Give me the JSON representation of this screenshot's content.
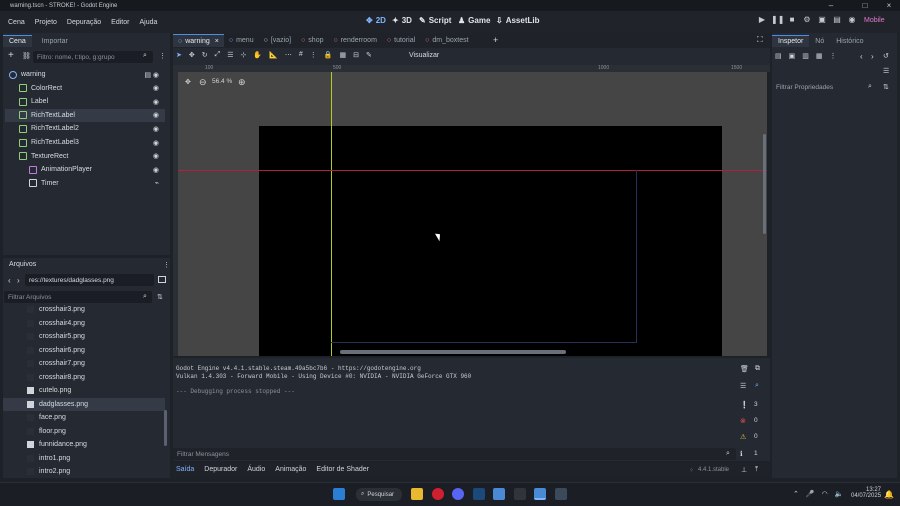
{
  "window": {
    "title": "warning.tscn - STROKE! - Godot Engine"
  },
  "menu": [
    "Cena",
    "Projeto",
    "Depuração",
    "Editor",
    "Ajuda"
  ],
  "workspaces": [
    {
      "label": "2D",
      "icon": "2d-icon",
      "active": true
    },
    {
      "label": "3D",
      "icon": "3d-icon"
    },
    {
      "label": "Script",
      "icon": "script-icon"
    },
    {
      "label": "Game",
      "icon": "game-icon"
    },
    {
      "label": "AssetLib",
      "icon": "assetlib-icon"
    }
  ],
  "renderer": "Mobile",
  "scene_panel": {
    "tabs": [
      "Cena",
      "Importar"
    ],
    "filter_placeholder": "Filtro: nome, t:tipo, g:grupo",
    "nodes": [
      {
        "name": "warning",
        "icon": "node-icon",
        "depth": 0
      },
      {
        "name": "ColorRect",
        "icon": "colorrect-icon",
        "depth": 1
      },
      {
        "name": "Label",
        "icon": "label-icon",
        "depth": 1
      },
      {
        "name": "RichTextLabel",
        "icon": "richtext-icon",
        "depth": 1,
        "selected": true
      },
      {
        "name": "RichTextLabel2",
        "icon": "richtext-icon",
        "depth": 1
      },
      {
        "name": "RichTextLabel3",
        "icon": "richtext-icon",
        "depth": 1
      },
      {
        "name": "TextureRect",
        "icon": "texturerect-icon",
        "depth": 1
      },
      {
        "name": "AnimationPlayer",
        "icon": "animationplayer-icon",
        "depth": 2
      },
      {
        "name": "Timer",
        "icon": "timer-icon",
        "depth": 2
      }
    ]
  },
  "files_panel": {
    "title": "Arquivos",
    "path": "res://textures/dadglasses.png",
    "filter_placeholder": "Filtrar Arquivos",
    "files": [
      "crosshair3.png",
      "crosshair4.png",
      "crosshair5.png",
      "crosshair6.png",
      "crosshair7.png",
      "crosshair8.png",
      "cutelo.png",
      "dadglasses.png",
      "face.png",
      "floor.png",
      "funnidance.png",
      "intro1.png",
      "intro2.png"
    ],
    "selected": "dadglasses.png"
  },
  "scene_tabs": [
    "warning",
    "menu",
    "[vazio]",
    "shop",
    "renderroom",
    "tutorial",
    "dm_boxtest"
  ],
  "toolbar": {
    "visualizar": "Visualizar",
    "zoom": "56.4 %"
  },
  "ruler_labels": [
    "100",
    "500",
    "1000",
    "1500"
  ],
  "inspector": {
    "tabs": [
      "Inspetor",
      "Nó",
      "Histórico"
    ],
    "filter_placeholder": "Filtrar Propriedades"
  },
  "output": {
    "lines": [
      "Godot Engine v4.4.1.stable.steam.49a5bc7b6 - https://godotengine.org",
      "Vulkan 1.4.303 - Forward Mobile - Using Device #0: NVIDIA - NVIDIA GeForce GTX 960",
      "",
      "--- Debugging process stopped ---"
    ],
    "filter_placeholder": "Filtrar Mensagens",
    "counts": {
      "messages": "3",
      "errors": "0",
      "warnings": "0",
      "info": "1"
    }
  },
  "bottom_tabs": [
    "Saída",
    "Depurador",
    "Áudio",
    "Animação",
    "Editor de Shader"
  ],
  "version": "4.4.1.stable",
  "taskbar": {
    "search": "Pesquisar",
    "time": "13:27",
    "date": "04/07/2025"
  }
}
